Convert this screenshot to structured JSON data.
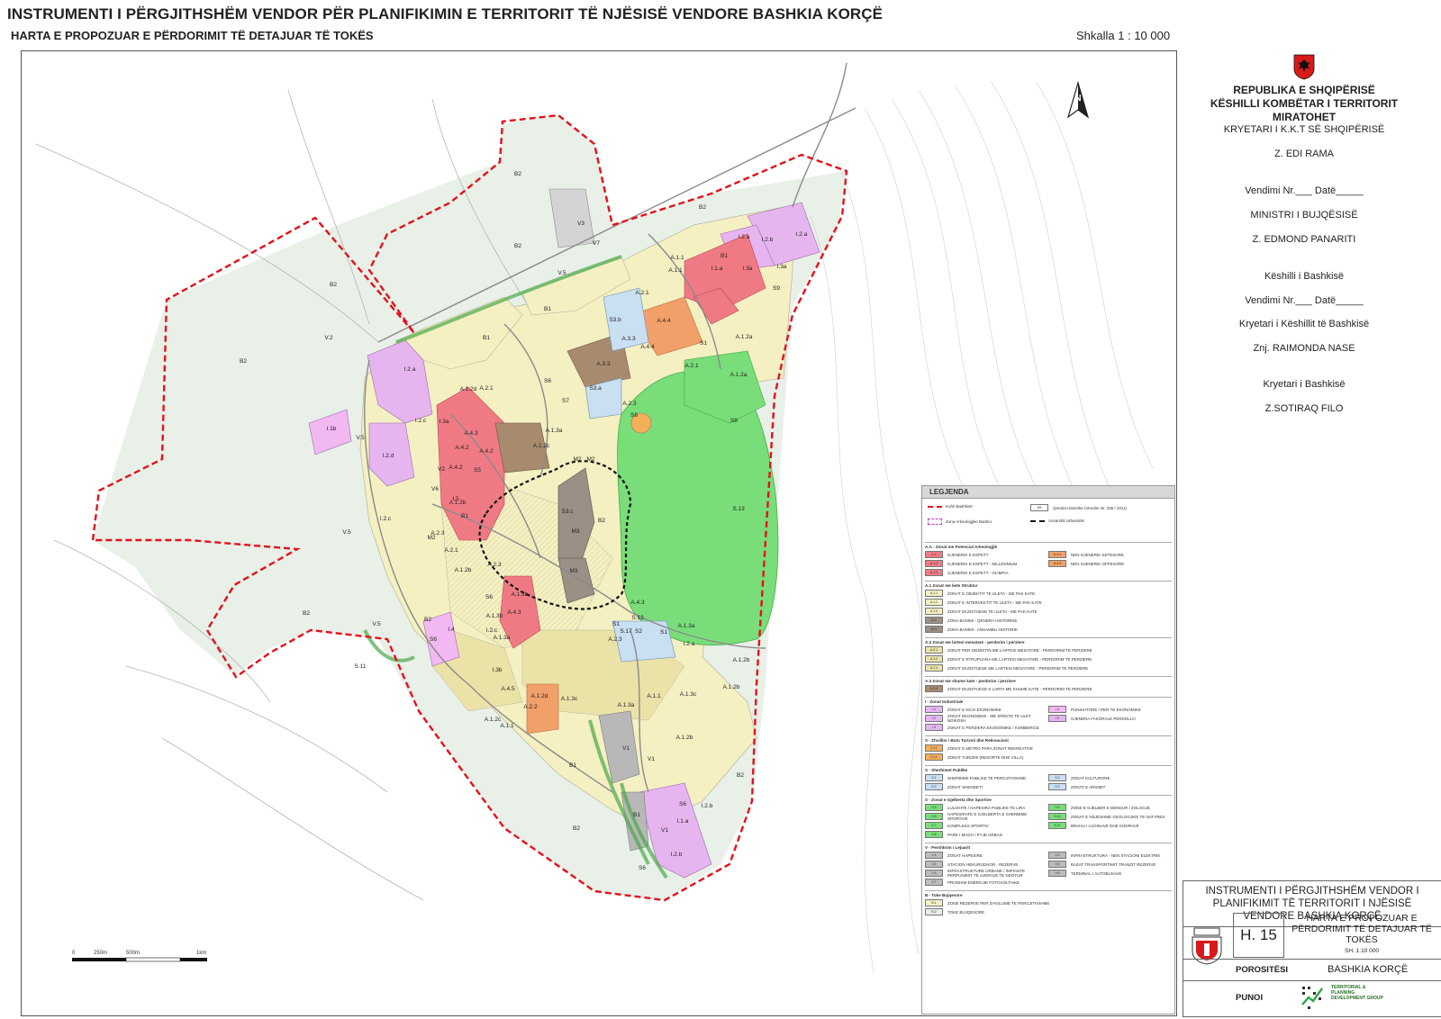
{
  "header": {
    "title": "INSTRUMENTI I PËRGJITHSHËM VENDOR PËR PLANIFIKIMIN E TERRITORIT TË NJËSISË VENDORE BASHKIA KORÇË",
    "subtitle": "HARTA E PROPOZUAR E PËRDORIMIT TË DETAJUAR TË TOKËS",
    "scale": "Shkalla 1 : 10 000"
  },
  "colors": {
    "residential": "#f4f0c2",
    "mixed": "#ebe2a8",
    "historic": "#f07a84",
    "industrial": "#e6b5f0",
    "green": "#79dd79",
    "agri": "#e6eee6",
    "service": "#c9dff2",
    "boundary": "#e4111b",
    "historic_core": "#111111"
  },
  "map": {
    "north": "N",
    "scalebar": [
      "0",
      "250m",
      "500m",
      "1km"
    ],
    "labels": [
      "B2",
      "B2",
      "B2",
      "B2",
      "V.2",
      "V.5",
      "V.5",
      "I.1b",
      "B1",
      "B1",
      "B2",
      "S.11",
      "V.5",
      "V3",
      "V7",
      "V.5",
      "B2",
      "I.2.a",
      "I.2.b",
      "I.2.a",
      "I.1.a",
      "I.3a",
      "I.3a",
      "S9",
      "B1",
      "A.1.1",
      "A.1.1",
      "A.2.1",
      "A.4.4",
      "A.4.4",
      "S1",
      "A.1.2a",
      "A.1.2a",
      "A.2.1",
      "S3.a",
      "A.3.3",
      "A.3.3",
      "S6",
      "S7",
      "S3.b",
      "A.1.2d",
      "A.2.1",
      "I.2.a",
      "I.2.c",
      "I.3a",
      "I.2.d",
      "V2",
      "A.4.3",
      "A.4.2",
      "A.4.2",
      "A.4.2",
      "S5",
      "V6",
      "I.5",
      "I.2.c",
      "A.1.2c",
      "A.1.3a",
      "A.2.3",
      "S8",
      "S.13",
      "S8",
      "B2",
      "M3",
      "M3",
      "M2",
      "M2",
      "M2",
      "A.2.1",
      "A.2.3",
      "A.2.3",
      "S6",
      "A.1.3b",
      "A.1.3a",
      "A.4.3",
      "A.4.3",
      "S.12",
      "S.17",
      "S1",
      "S2",
      "S1",
      "I.2.a",
      "A.1.2b",
      "A.1.2b",
      "A.1.2b",
      "A.1.1",
      "A.1.3c",
      "A.1.3c",
      "A.1.2d",
      "A.4.5",
      "A.2.2",
      "A.2.3",
      "A.1.3a",
      "V1",
      "V1",
      "S6",
      "A.1.1",
      "A.1.2c",
      "B1",
      "B1",
      "V1",
      "I.1.a",
      "I.2.b",
      "I.2.b",
      "S6",
      "B2",
      "B2",
      "B2",
      "S6",
      "I.4",
      "I.3b",
      "A.1.2b",
      "B1",
      "S3.c",
      "A.1.2b",
      "I.2.c",
      "A.1.3b",
      "A.1.3a",
      "S4"
    ]
  },
  "legend": {
    "title": "LEGJENDA",
    "top_items": [
      "Kufiri Bashkisë",
      "Qendra Historike (Vendim Nr. 336 / 2011)",
      "Zona Arkeologjike Bantini",
      "Ansambli Urbanistik"
    ],
    "top_codes": [
      "M3"
    ],
    "sections": [
      {
        "title": "A.A - Zonat me Potencial Arkeologjik",
        "items": [
          [
            "A.1",
            "GJENERIK E ESPETT"
          ],
          [
            "A.4.4",
            "NEN GJENERIK KETESORE"
          ],
          [
            "A.4.2",
            "GJENERIK E ESPETT - MILLENNIUM"
          ],
          [
            "A.4.5",
            "NEN GJENERIK OFFESORE"
          ],
          [
            "A.4.3",
            "GJENERIK E ESPETT - OLIMPIA"
          ]
        ]
      },
      {
        "title": "A.1 Zonat me kete Struktur",
        "items": [
          [
            "A.1.1",
            "ZONAT E OBJEKTIT TE ULETA - ME PAK KATE"
          ],
          [
            "A.1.2",
            "ZONAT E INTERVEKTIT TE ULETA - ME PAK KATE"
          ],
          [
            "A.1.3",
            "ZONAT EKZISTUESE TE ULETA - ME PAK KATE"
          ],
          [
            "M.2",
            "ZONA BANIMI - QENDRA HISTORIKE"
          ],
          [
            "M.3",
            "ZONA BANIMI - ANSAMBLI HISTORIK"
          ]
        ]
      },
      {
        "title": "A.2 Zonat me lartesi mesatare - perdorim i perziere",
        "items": [
          [
            "A.2.1",
            "ZONAT PER OBJEKTIN ME LARTESI MESATARE - PERDORIM TE PERZIERE"
          ],
          [
            "A.2.2",
            "ZONAT E RTRUPUARA ME LARTESI MESATARE - PERDORIM TE PERZIERE"
          ],
          [
            "A.2.3",
            "ZONAT EKZISTUESE ME LARTESI MESATARE - PERDORIM TE PERZIERE"
          ]
        ]
      },
      {
        "title": "A.3 Zonat me shume kate - perdorim i perziere",
        "items": [
          [
            "A.3.3",
            "ZONAT EKZISTUESE E LARTA ME SHUME KATE - PERDORIM TE PERZIERE"
          ]
        ]
      },
      {
        "title": "I - Zonat Industriale",
        "items": [
          [
            "I.1",
            "ZONAT E KEJA EKONOMIKE"
          ],
          [
            "I.4",
            "PUNISHTORE / PER TE EKONOMIKE"
          ],
          [
            "I.2",
            "ZONAT EKONOMIKE - ME SPEKTE TE ULET NDIKOSH"
          ],
          [
            "I.5",
            "GJENERA FAKORALE PERDOLLO"
          ],
          [
            "I.3",
            "ZONAT E PERZIERA EKONOMIKE / KOMBERICE"
          ]
        ]
      },
      {
        "title": "S - Zhvillim i Butu Turizmi dhe Rekreacioni",
        "items": [
          [
            "S.12",
            "ZONAT E METRO PARA ZONAT REKREATIVE"
          ],
          [
            "S.13",
            "ZONAT TURIZMI (RESORTE DHE VILLA)"
          ]
        ]
      },
      {
        "title": "S - Sherbimet Publike",
        "items": [
          [
            "S.1",
            "SHERBIME PUBLIKE TE PERGJITHSHME"
          ],
          [
            "S.4",
            "ZONAT KULTURORE"
          ],
          [
            "S.2",
            "ZONAT SHENDETI"
          ],
          [
            "S.3",
            "ZONAT E ARSIMIT"
          ]
        ]
      },
      {
        "title": "S - Zonat e Gjelberta dhe Sportive",
        "items": [
          [
            "S.5",
            "LULISHTE / HAPESIRA PUBLIKE TE LIRA"
          ],
          [
            "S.9",
            "ZONE E GJELBER E DENDUR / ZOLOGJE"
          ],
          [
            "S.6",
            "HAPESIRATE E GJELBERTA E SHERBIME SPORTIVE"
          ],
          [
            "S.10",
            "ZONAT E NDJESHME GEOLOGJIKE TE NATYRES"
          ],
          [
            "S.7",
            "KOMPLEKS SPORTIV"
          ],
          [
            "S.11",
            "BRAHU I LUGINAVE DHE KODRAVE"
          ],
          [
            "S.8",
            "PARK I MADH / PYJE URBAN"
          ]
        ]
      },
      {
        "title": "V - Pershkrim i Lejuarit",
        "items": [
          [
            "V.1",
            "ZONAT HAPESIRE"
          ],
          [
            "V.4",
            "INFRASTRUKTURA - NEN STACIONI ELEKTRIK"
          ],
          [
            "V.2",
            "STACION HEKURUDHOR - REZERVE"
          ],
          [
            "V.5",
            "BAZAT TRANSPORTIMIT TRANZIT REZERVE"
          ],
          [
            "V.3",
            "INFRASTRUKTURE URBANE / IMPIANTE PERPUNIMIT TE UJERAVE TE NDOTUR"
          ],
          [
            "V.6",
            "TERMINAL I AUTOBUSAVE"
          ],
          [
            "V.7",
            "PRODHIM ENERGJIE FOTOVOLTAIKE"
          ]
        ]
      },
      {
        "title": "B - Toke Bujqesore",
        "items": [
          [
            "B.1",
            "ZONE REZERVE PER ZHVILLIME TE PERGJITHSHME"
          ],
          [
            "B.2",
            "TOKE BUJQESORE"
          ]
        ]
      }
    ]
  },
  "approval": {
    "republic": "REPUBLIKA E SHQIPËRISË",
    "council": "KËSHILLI KOMBËTAR I TERRITORIT",
    "approved": "MIRATOHET",
    "chair": "KRYETARI I K.K.T SË SHQIPËRISË",
    "chair_name": "Z. EDI RAMA",
    "decision_1": "Vendimi Nr.___ Datë_____",
    "minister": "MINISTRI I BUJQËSISË",
    "minister_name": "Z. EDMOND PANARITI",
    "municipal_council": "Këshilli i Bashkisë",
    "decision_2": "Vendimi Nr.___ Datë_____",
    "council_chair": "Kryetari i Këshillit të Bashkisë",
    "council_chair_name": "Znj. RAIMONDA NASE",
    "mayor": "Kryetari i Bashkisë",
    "mayor_name": "Z.SOTIRAQ FILO"
  },
  "title_block": {
    "title": "INSTRUMENTI I PËRGJITHSHËM VENDOR I PLANIFIKIMIT TË TERRITORIT I NJËSISË VENDORE BASHKIA KORÇË",
    "code": "H. 15",
    "map_title": "HARTA E PROPOZUAR E PËRDORIMIT TË DETAJUAR TË TOKËS",
    "map_scale": "SH. 1:10 000",
    "commissioned_label": "POROSITËSI",
    "commissioned_value": "BASHKIA KORÇË",
    "prepared_label": "PUNOI",
    "firm": "TERRITORIAL & PLANNING DEVELOPMENT GROUP"
  }
}
